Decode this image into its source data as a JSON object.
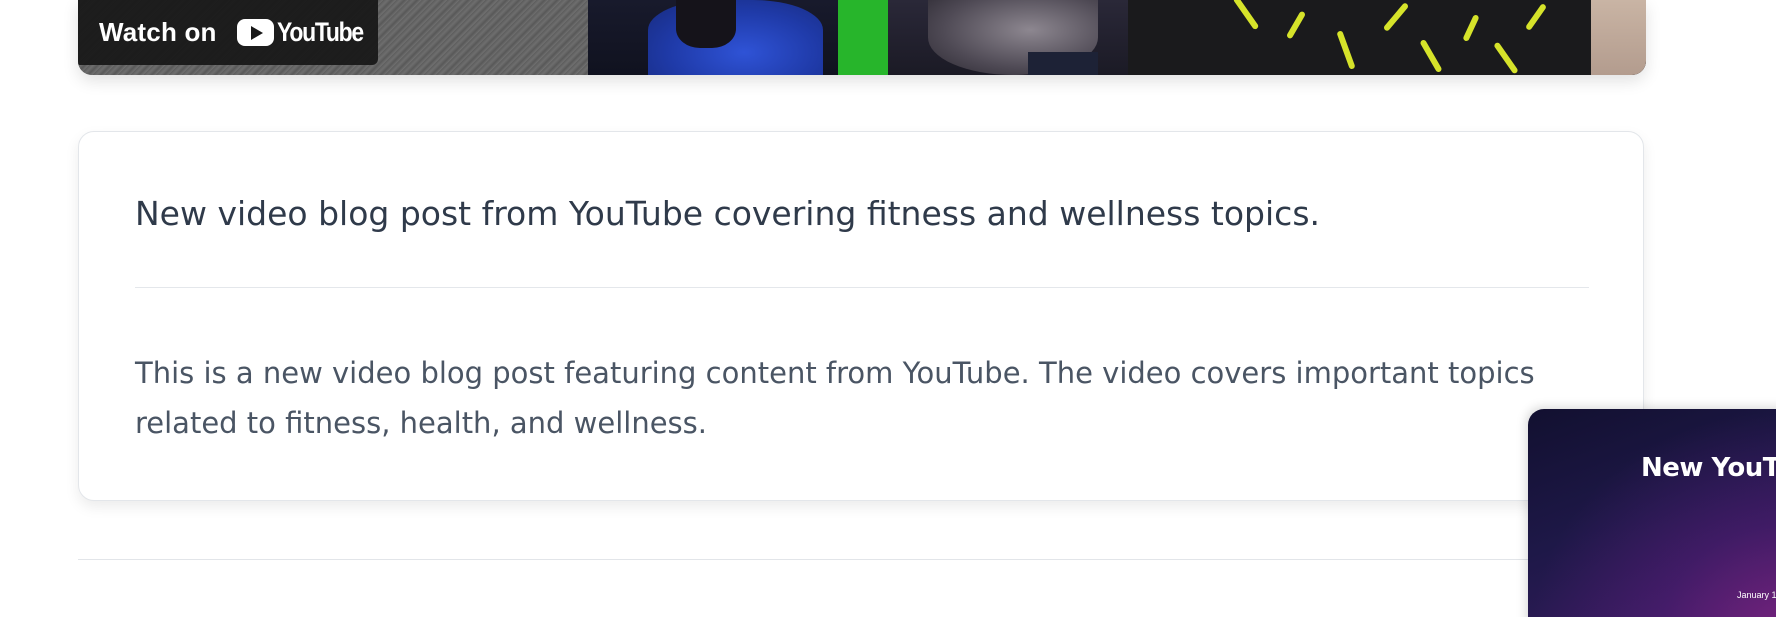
{
  "video_embed": {
    "watch_label": "Watch on",
    "platform_name": "YouTube",
    "icons": [
      "youtube-play-icon"
    ]
  },
  "post": {
    "title": "New video blog post from YouTube covering fitness and wellness topics.",
    "body": "This is a new video blog post featuring content from YouTube. The video covers important topics related to fitness, health, and wellness."
  },
  "floating_preview": {
    "title": "New YouT",
    "date": "January 1"
  },
  "colors": {
    "title_text": "#2f3a4a",
    "body_text": "#4a5564",
    "card_border": "#e3e6ea",
    "badge_bg": "#171717",
    "preview_bg": "#1e1848"
  }
}
